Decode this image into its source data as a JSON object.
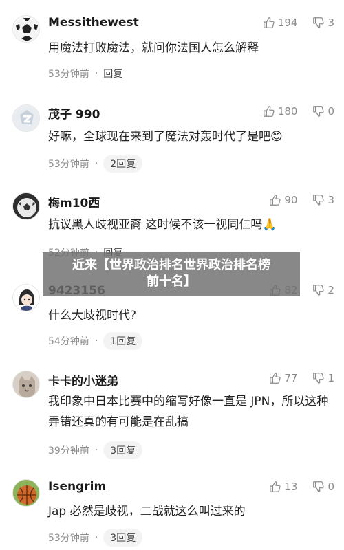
{
  "comments": [
    {
      "username": "Messithewest",
      "likes": "194",
      "dislikes": "3",
      "text": "用魔法打败魔法，就问你法国人怎么解释",
      "time": "53分钟前",
      "reply": "回复",
      "avatar": "soccer-ball"
    },
    {
      "username": "茂子 990",
      "likes": "180",
      "dislikes": "0",
      "text": "好嘛，全球现在来到了魔法对轰时代了是吧😊",
      "time": "53分钟前",
      "reply": "2回复",
      "avatar": "gray-badge"
    },
    {
      "username": "梅m10西",
      "likes": "90",
      "dislikes": "3",
      "text": "抗议黑人歧视亚裔 这时候不该一视同仁吗🙏",
      "time": "52分钟前",
      "reply": "回复",
      "avatar": "soccer-ball-dark"
    },
    {
      "username": "9423156",
      "likes": "82",
      "dislikes": "2",
      "text": "什么大歧视时代?",
      "time": "54分钟前",
      "reply": "1回复",
      "avatar": "cartoon-girl"
    },
    {
      "username": "卡卡的小迷弟",
      "likes": "77",
      "dislikes": "1",
      "text": "我印象中日本比赛中的缩写好像一直是 JPN，所以这种弄错还真的有可能是在乱搞",
      "time": "39分钟前",
      "reply": "3回复",
      "avatar": "cat"
    },
    {
      "username": "Isengrim",
      "likes": "13",
      "dislikes": "0",
      "text": "Jap 必然是歧视，二战就这么叫过来的",
      "time": "53分钟前",
      "reply": "3回复",
      "avatar": "basketball"
    }
  ],
  "overlay": {
    "line1": "近来【世界政治排名世界政治排名榜",
    "line2": "前十名】"
  },
  "colors": {
    "text": "#222222",
    "muted": "#8a8a8a",
    "overlay_bg": "#6e6e6e"
  }
}
